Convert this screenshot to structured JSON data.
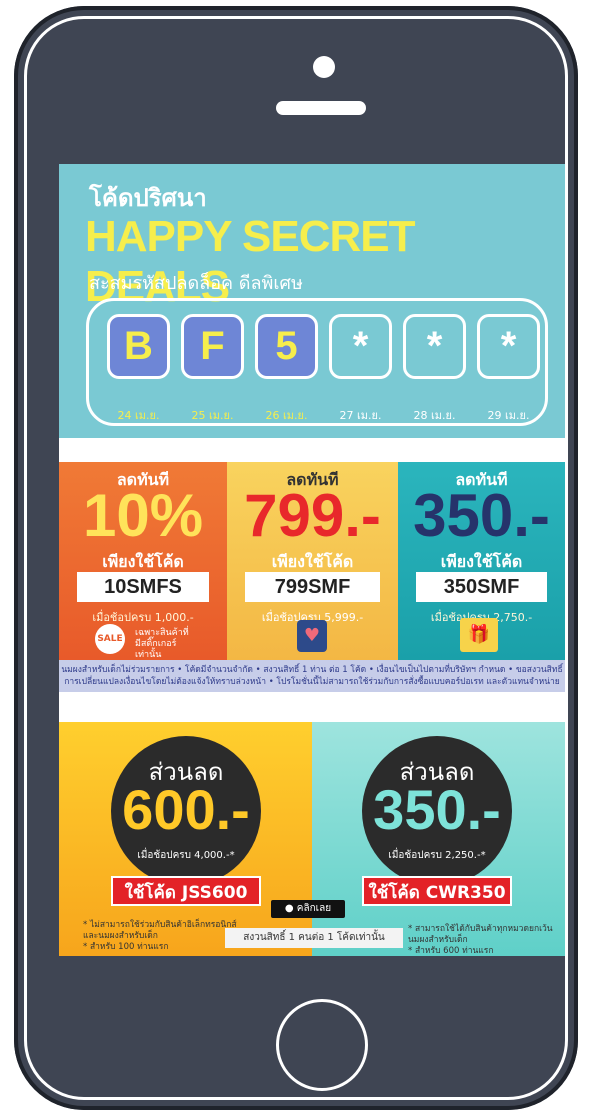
{
  "banner1": {
    "subtitle": "โค้ดปริศนา",
    "title": "HAPPY SECRET DEALS",
    "tagline": "สะสมรหัสปลดล็อค ดีลพิเศษ",
    "slots": [
      {
        "char": "B",
        "date": "24 เม.ย."
      },
      {
        "char": "F",
        "date": "25 เม.ย."
      },
      {
        "char": "5",
        "date": "26 เม.ย."
      },
      {
        "char": "*",
        "date": "27 เม.ย."
      },
      {
        "char": "*",
        "date": "28 เม.ย."
      },
      {
        "char": "*",
        "date": "29 เม.ย."
      }
    ]
  },
  "banner2": {
    "panels": [
      {
        "lead": "ลดทันที",
        "amount": "10%",
        "use": "เพียงใช้โค้ด",
        "code": "10SMFS",
        "min": "เมื่อช้อปครบ 1,000.-",
        "note": "เฉพาะสินค้าที่\nมีสติ๊กเกอร์\nเท่านั้น",
        "icon": "SALE"
      },
      {
        "lead": "ลดทันที",
        "amount": "799.-",
        "use": "เพียงใช้โค้ด",
        "code": "799SMF",
        "min": "เมื่อช้อปครบ 5,999.-"
      },
      {
        "lead": "ลดทันที",
        "amount": "350.-",
        "use": "เพียงใช้โค้ด",
        "code": "350SMF",
        "min": "เมื่อช้อปครบ 2,750.-"
      }
    ],
    "fine_print": "นมผงสำหรับเด็กไม่ร่วมรายการ • โค้ดมีจำนวนจำกัด • สงวนสิทธิ์ 1 ท่าน ต่อ 1 โค้ด • เงื่อนไขเป็นไปตามที่บริษัทฯ กำหนด • ขอสงวนสิทธิ์การเปลี่ยนแปลงเงื่อนไขโดยไม่ต้องแจ้งให้ทราบล่วงหน้า • โปรโมชั่นนี้ไม่สามารถใช้ร่วมกับการสั่งซื้อแบบคอร์ปอเรท และตัวแทนจำหน่าย"
  },
  "banner3": {
    "left": {
      "lead": "ส่วนลด",
      "amount": "600.-",
      "min": "เมื่อช้อปครบ 4,000.-*",
      "code_label": "ใช้โค้ด JSS600",
      "note": "* ไม่สามารถใช้ร่วมกับสินค้าอิเล็กทรอนิกส์\nและนมผงสำหรับเด็ก\n* สำหรับ 100 ท่านแรก"
    },
    "right": {
      "lead": "ส่วนลด",
      "amount": "350.-",
      "min": "เมื่อช้อปครบ 2,250.-*",
      "code_label": "ใช้โค้ด CWR350",
      "note": "* สามารถใช้ได้กับสินค้าทุกหมวดยกเว้นนมผงสำหรับเด็ก\n* สำหรับ 600 ท่านแรก"
    },
    "click_label": "● คลิกเลย",
    "rights": "สงวนสิทธิ์ 1 คนต่อ 1 โค้ดเท่านั้น"
  },
  "colors": {
    "frame": "#3f4553",
    "accent_yellow": "#f6ee4c",
    "slot_blue": "#6e86d6",
    "banner1_bg": "#7ac9d3",
    "code_red": "#e32227"
  }
}
